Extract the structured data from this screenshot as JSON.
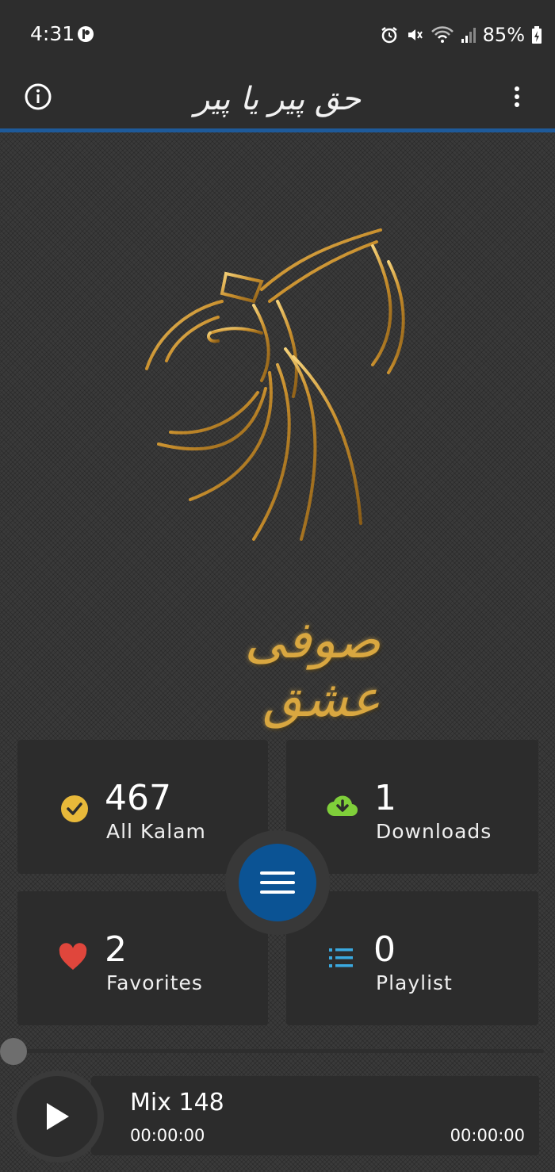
{
  "status_bar": {
    "time": "4:31",
    "battery": "85%",
    "icons": [
      "app-notification-icon",
      "alarm-icon",
      "mute-icon",
      "wifi-icon",
      "signal-icon",
      "battery-charging-icon"
    ]
  },
  "app_bar": {
    "title": "حق پیر یا پیر",
    "left_icon": "info-icon",
    "right_icon": "more-vert-icon"
  },
  "hero": {
    "calligraphy": "صوفی عشق",
    "art": "whirling-dervish-illustration",
    "accent_color": "#d9a740"
  },
  "tiles": {
    "all_kalam": {
      "count": "467",
      "label": "All Kalam",
      "icon": "check-circle-icon",
      "icon_color": "#e8b93a"
    },
    "downloads": {
      "count": "1",
      "label": "Downloads",
      "icon": "cloud-download-icon",
      "icon_color": "#7fcf3a"
    },
    "favorites": {
      "count": "2",
      "label": "Favorites",
      "icon": "heart-icon",
      "icon_color": "#e0463c"
    },
    "playlist": {
      "count": "0",
      "label": "Playlist",
      "icon": "list-icon",
      "icon_color": "#3aa9e0"
    }
  },
  "menu_button": {
    "icon": "hamburger-menu-icon",
    "color": "#0b5394"
  },
  "player": {
    "track_title": "Mix 148",
    "elapsed": "00:00:00",
    "total": "00:00:00",
    "progress": 0,
    "play_icon": "play-icon"
  },
  "colors": {
    "app_bar": "#2d2d2d",
    "app_bar_accent_line": "#1e5a9a",
    "tile_background": "#2c2c2c"
  }
}
